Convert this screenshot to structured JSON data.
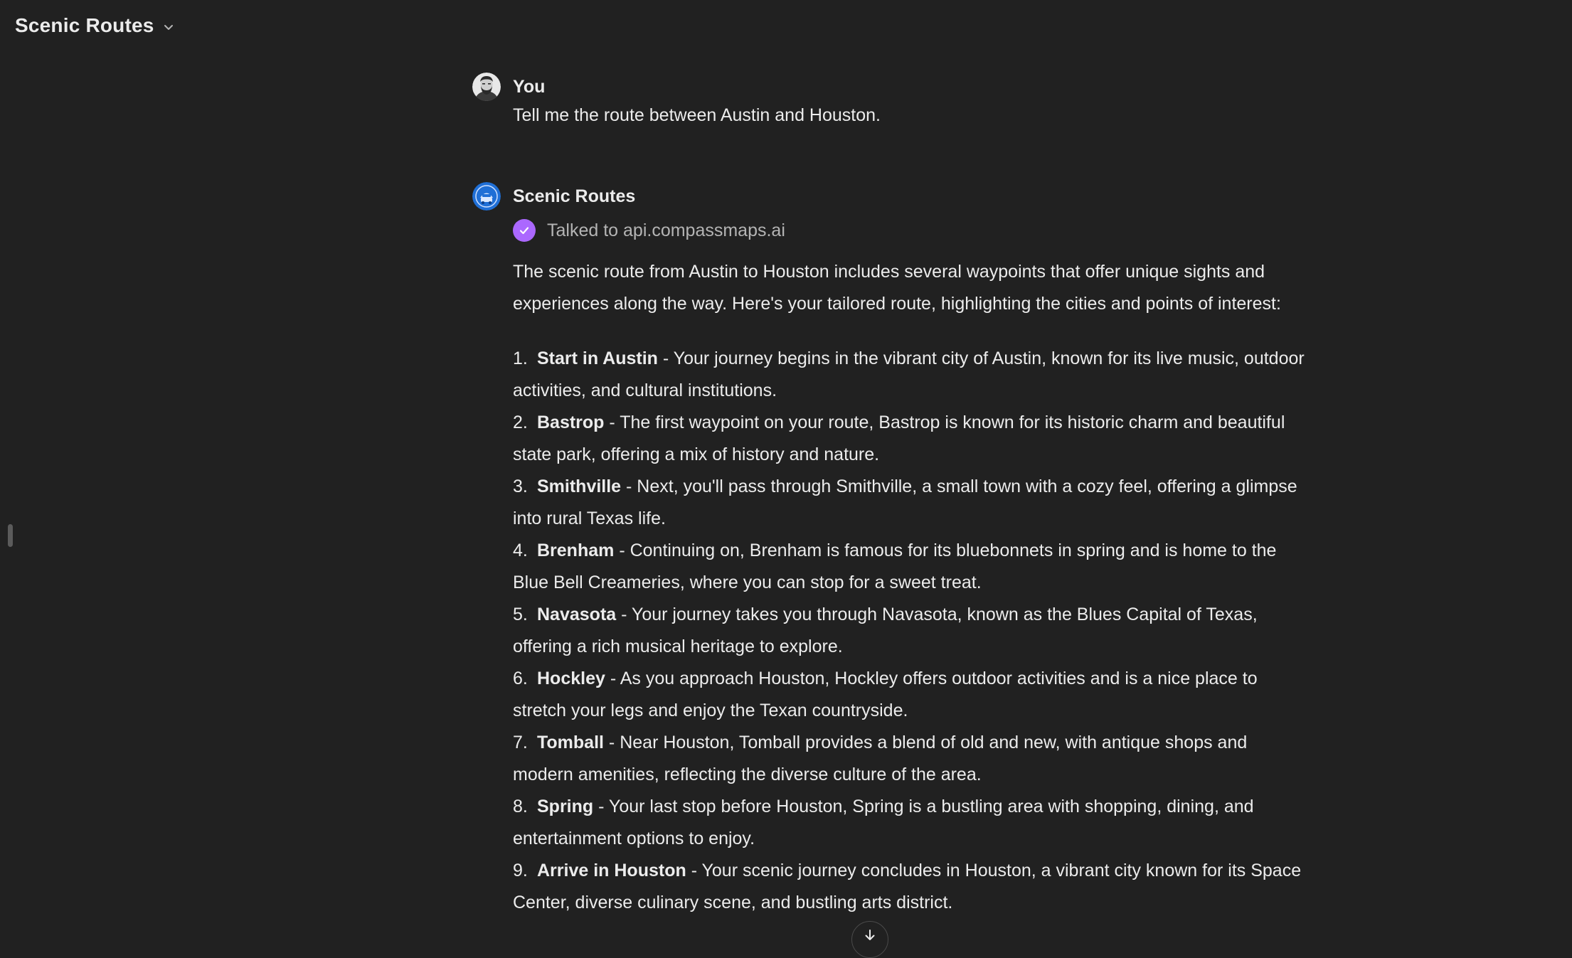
{
  "header": {
    "title": "Scenic Routes"
  },
  "thread": {
    "user_message": {
      "sender": "You",
      "text": "Tell me the route between Austin and Houston."
    },
    "assistant_message": {
      "sender": "Scenic Routes",
      "tool_status": "Talked to api.compassmaps.ai",
      "intro": "The scenic route from Austin to Houston includes several waypoints that offer unique sights and experiences along the way. Here's your tailored route, highlighting the cities and points of interest:",
      "waypoints": [
        {
          "num": "1.",
          "name": "Start in Austin",
          "desc": " - Your journey begins in the vibrant city of Austin, known for its live music, outdoor activities, and cultural institutions."
        },
        {
          "num": "2.",
          "name": "Bastrop",
          "desc": " - The first waypoint on your route, Bastrop is known for its historic charm and beautiful state park, offering a mix of history and nature."
        },
        {
          "num": "3.",
          "name": "Smithville",
          "desc": " - Next, you'll pass through Smithville, a small town with a cozy feel, offering a glimpse into rural Texas life."
        },
        {
          "num": "4.",
          "name": "Brenham",
          "desc": " - Continuing on, Brenham is famous for its bluebonnets in spring and is home to the Blue Bell Creameries, where you can stop for a sweet treat."
        },
        {
          "num": "5.",
          "name": "Navasota",
          "desc": " - Your journey takes you through Navasota, known as the Blues Capital of Texas, offering a rich musical heritage to explore."
        },
        {
          "num": "6.",
          "name": "Hockley",
          "desc": " - As you approach Houston, Hockley offers outdoor activities and is a nice place to stretch your legs and enjoy the Texan countryside."
        },
        {
          "num": "7.",
          "name": "Tomball",
          "desc": " - Near Houston, Tomball provides a blend of old and new, with antique shops and modern amenities, reflecting the diverse culture of the area."
        },
        {
          "num": "8.",
          "name": "Spring",
          "desc": " - Your last stop before Houston, Spring is a bustling area with shopping, dining, and entertainment options to enjoy."
        },
        {
          "num": "9.",
          "name": "Arrive in Houston",
          "desc": " - Your scenic journey concludes in Houston, a vibrant city known for its Space Center, diverse culinary scene, and bustling arts district."
        }
      ]
    }
  },
  "colors": {
    "background": "#212121",
    "text": "#ececec",
    "muted_text": "#b4b4b4",
    "tool_check": "#ab68ff",
    "gpt_avatar": "#1f6fd6"
  },
  "icons": {
    "title_dropdown": "chevron-down-icon",
    "user_avatar": "user-avatar-icon",
    "gpt_avatar": "scenic-routes-logo-icon",
    "tool_status": "check-circle-icon",
    "scroll_down": "arrow-down-icon"
  }
}
